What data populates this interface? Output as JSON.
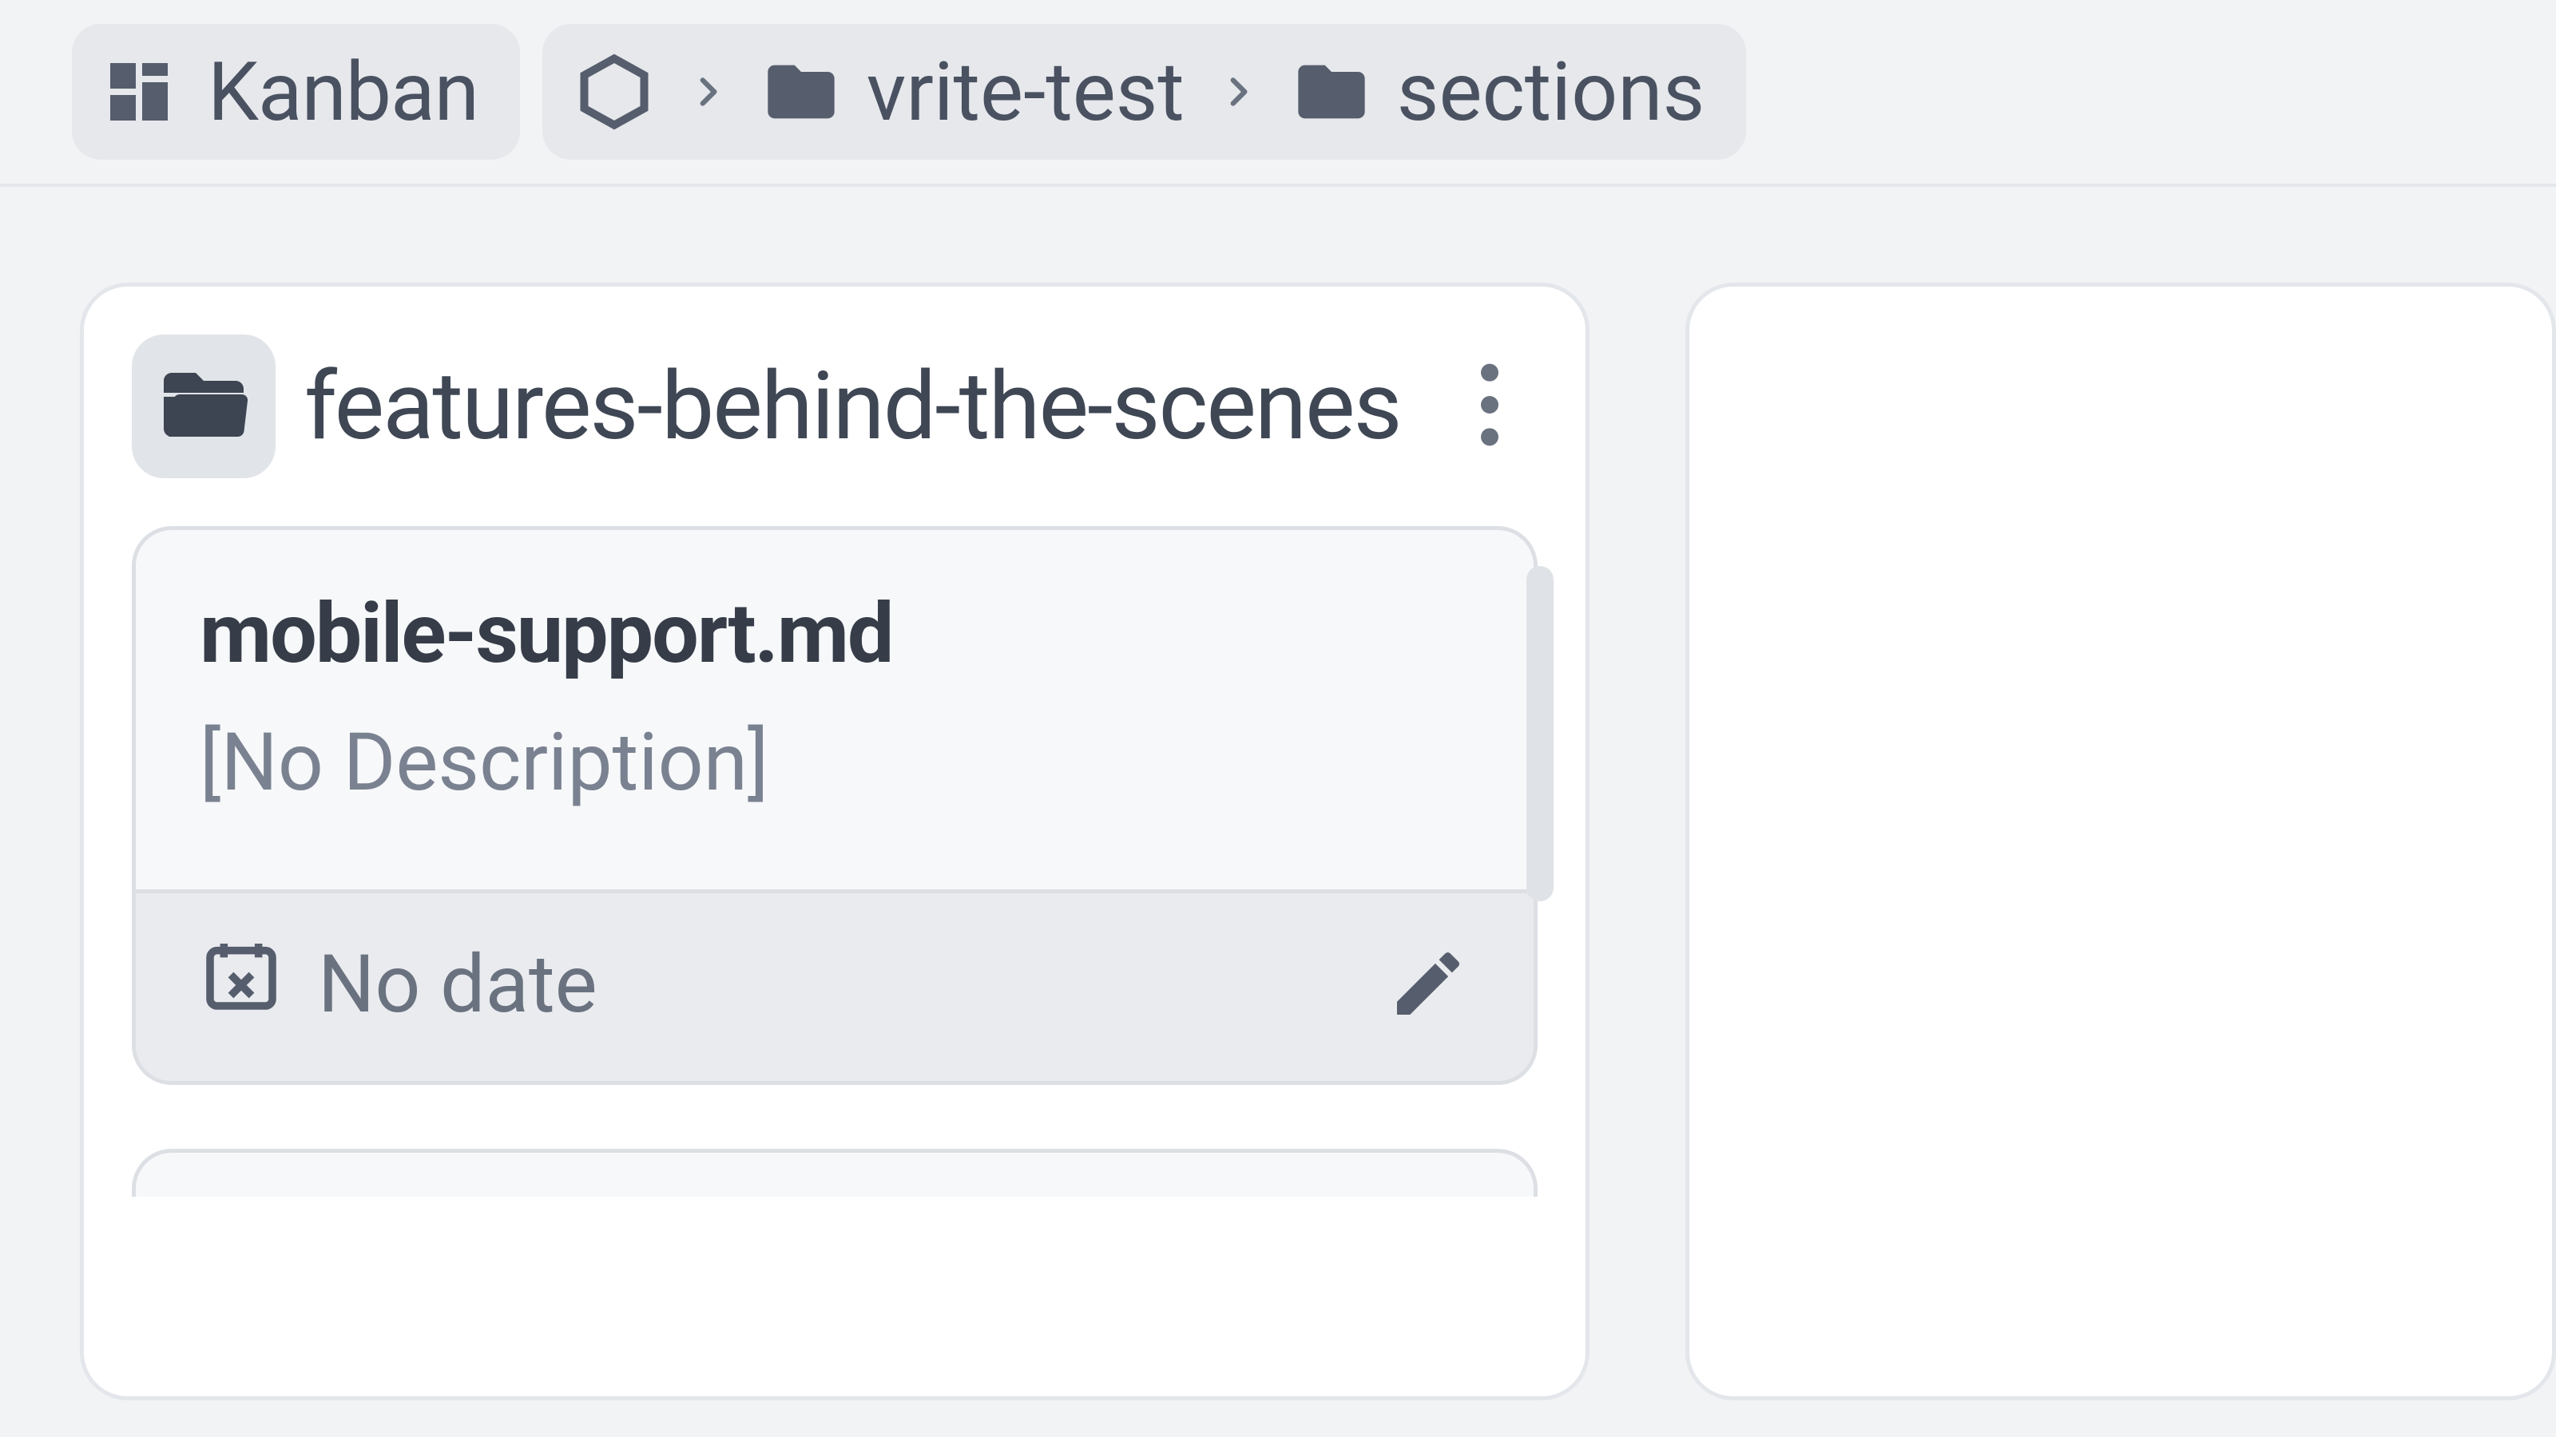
{
  "toolbar": {
    "view_label": "Kanban"
  },
  "breadcrumb": {
    "items": [
      {
        "label": "vrite-test"
      },
      {
        "label": "sections"
      }
    ]
  },
  "column": {
    "title": "features-behind-the-scenes",
    "cards": [
      {
        "title": "mobile-support.md",
        "description": "[No Description]",
        "date_text": "No date"
      }
    ]
  }
}
